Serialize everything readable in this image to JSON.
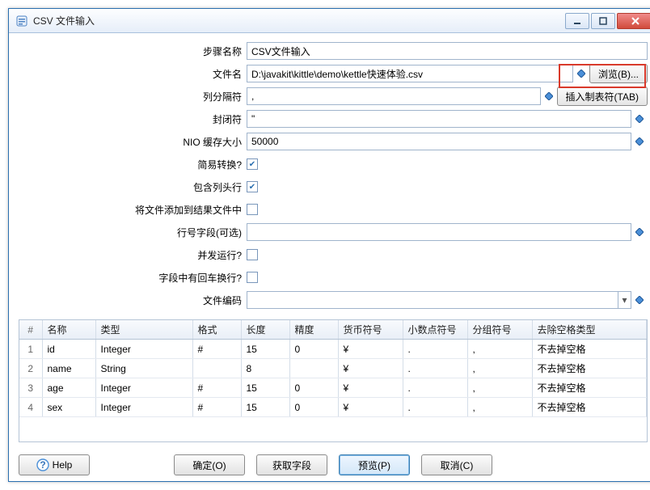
{
  "window": {
    "title": "CSV 文件输入"
  },
  "form": {
    "step_name": {
      "label": "步骤名称",
      "value": "CSV文件输入"
    },
    "file_name": {
      "label": "文件名",
      "value": "D:\\javakit\\kittle\\demo\\kettle快速体验.csv",
      "browse_label": "浏览(B)..."
    },
    "delimiter": {
      "label": "列分隔符",
      "value": ",",
      "tab_button_label": "插入制表符(TAB)"
    },
    "enclosure": {
      "label": "封闭符",
      "value": "\""
    },
    "nio_buffer": {
      "label": "NIO 缓存大小",
      "value": "50000"
    },
    "lazy": {
      "label": "简易转换?",
      "checked": true
    },
    "header": {
      "label": "包含列头行",
      "checked": true
    },
    "add_to_result": {
      "label": "将文件添加到结果文件中",
      "checked": false
    },
    "rownum_field": {
      "label": "行号字段(可选)",
      "value": ""
    },
    "parallel": {
      "label": "并发运行?",
      "checked": false
    },
    "newline_in_field": {
      "label": "字段中有回车换行?",
      "checked": false
    },
    "encoding": {
      "label": "文件编码",
      "value": ""
    }
  },
  "table": {
    "headers": {
      "hash": "#",
      "name": "名称",
      "type": "类型",
      "format": "格式",
      "length": "长度",
      "precision": "精度",
      "currency": "货币符号",
      "decimal": "小数点符号",
      "group": "分组符号",
      "trim": "去除空格类型"
    },
    "rows": [
      {
        "idx": "1",
        "name": "id",
        "type": "Integer",
        "format": "#",
        "length": "15",
        "precision": "0",
        "currency": "¥",
        "decimal": ".",
        "group": ",",
        "trim": "不去掉空格"
      },
      {
        "idx": "2",
        "name": "name",
        "type": "String",
        "format": "",
        "length": "8",
        "precision": "",
        "currency": "¥",
        "decimal": ".",
        "group": ",",
        "trim": "不去掉空格"
      },
      {
        "idx": "3",
        "name": "age",
        "type": "Integer",
        "format": "#",
        "length": "15",
        "precision": "0",
        "currency": "¥",
        "decimal": ".",
        "group": ",",
        "trim": "不去掉空格"
      },
      {
        "idx": "4",
        "name": "sex",
        "type": "Integer",
        "format": "#",
        "length": "15",
        "precision": "0",
        "currency": "¥",
        "decimal": ".",
        "group": ",",
        "trim": "不去掉空格"
      }
    ]
  },
  "buttons": {
    "help": "Help",
    "ok": "确定(O)",
    "get_fields": "获取字段",
    "preview": "预览(P)",
    "cancel": "取消(C)"
  }
}
